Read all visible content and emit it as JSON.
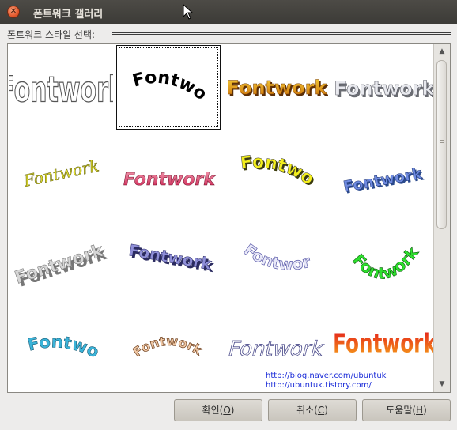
{
  "window": {
    "title": "폰트워크 갤러리"
  },
  "section": {
    "label": "폰트워크 스타일 선택:"
  },
  "gallery": {
    "items": [
      {
        "text": "Fontwork",
        "style": "outline"
      },
      {
        "text": "Fontwork",
        "style": "arched-black"
      },
      {
        "text": "Fontwork",
        "style": "orange-3d"
      },
      {
        "text": "Fontwork",
        "style": "gray-3d"
      },
      {
        "text": "Fontwork",
        "style": "yellow-slant"
      },
      {
        "text": "Fontwork",
        "style": "red-perspective"
      },
      {
        "text": "Fontwork",
        "style": "yellow-3d"
      },
      {
        "text": "Fontwork",
        "style": "blue-3d"
      },
      {
        "text": "Fontwork",
        "style": "silver-3d"
      },
      {
        "text": "Fontwork",
        "style": "navy-3d"
      },
      {
        "text": "Fontwork",
        "style": "lavender-3d"
      },
      {
        "text": "Fontwork",
        "style": "green-arch"
      },
      {
        "text": "Fontwork",
        "style": "teal-wave"
      },
      {
        "text": "Fontwork",
        "style": "brown-arch"
      },
      {
        "text": "Fontwork",
        "style": "outline-perspective"
      },
      {
        "text": "Fontwork",
        "style": "red-gradient"
      }
    ],
    "selected_index": 1
  },
  "watermark": {
    "line1": "http://blog.naver.com/ubuntuk",
    "line2": "http://ubuntuk.tistory.com/"
  },
  "buttons": {
    "ok": {
      "label": "확인(",
      "mnemonic": "O",
      "close": ")"
    },
    "cancel": {
      "label": "취소(",
      "mnemonic": "C",
      "close": ")"
    },
    "help": {
      "label": "도움말(",
      "mnemonic": "H",
      "close": ")"
    }
  },
  "colors": {
    "titlebar": "#3c3b37",
    "close": "#e3582c",
    "link": "#1a2bd8"
  }
}
